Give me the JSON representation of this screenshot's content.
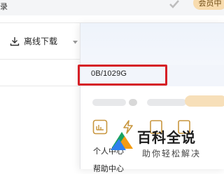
{
  "window": {
    "title_fragment": "录"
  },
  "toolbar": {
    "download_label": "离线下载"
  },
  "vip": {
    "label": "会员中"
  },
  "account_panel": {
    "storage_text": "0B/1029G",
    "personal_center_label": "个人中心",
    "help_center_label": "帮助中心"
  },
  "watermark": {
    "title": "百科全说",
    "subtitle": "助你轻松解决"
  },
  "colors": {
    "highlight_border": "#d61f26",
    "vip_pill": "#f8dcaf",
    "panel_header": "#eef3fb",
    "icon_gold": "#c8963e"
  },
  "icons": [
    "download-icon",
    "chevron-down-icon",
    "check-icon",
    "card-icon",
    "lightning-icon",
    "bookmark-icon",
    "document-icon",
    "logo-icon"
  ]
}
